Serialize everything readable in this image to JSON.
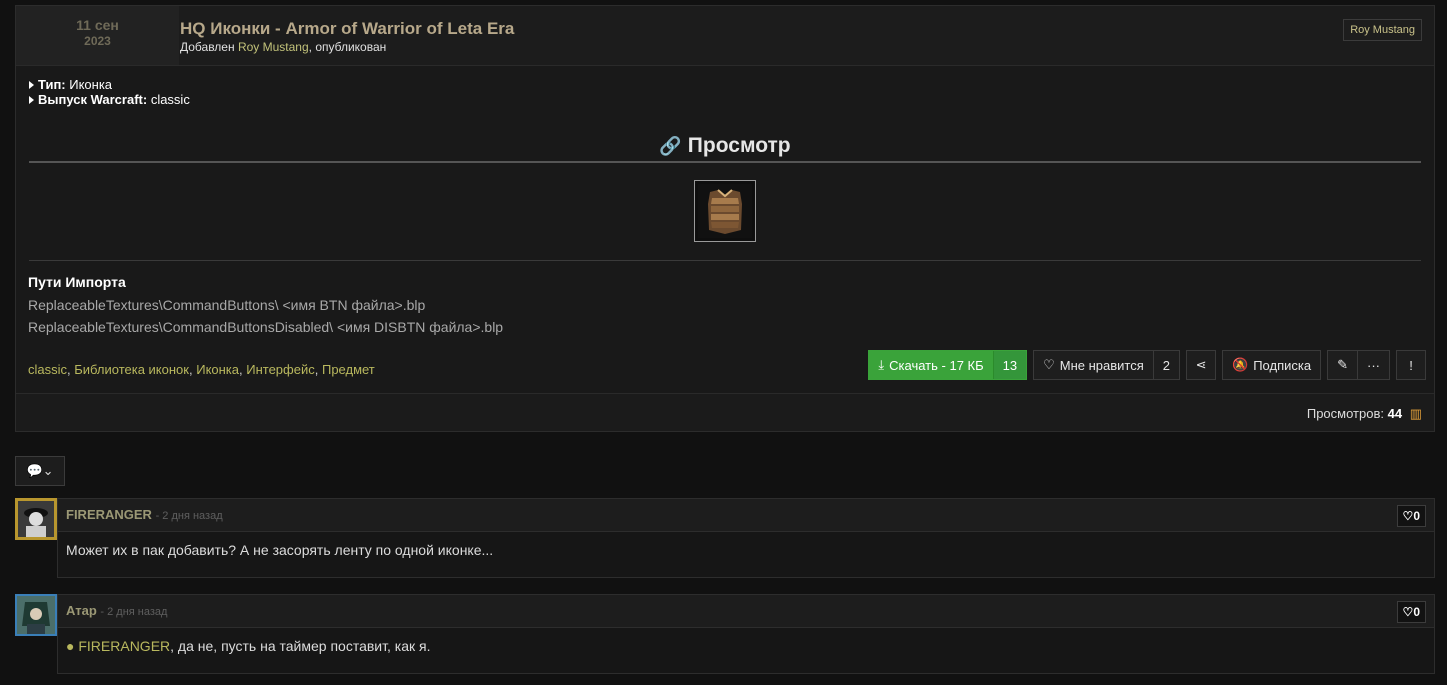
{
  "post": {
    "date_day": "11 сен",
    "date_year": "2023",
    "title": "HQ Иконки - Armor of Warrior of Leta Era",
    "added_prefix": "Добавлен",
    "author": "Roy Mustang",
    "published_suffix": ", опубликован",
    "author_badge": "Roy Mustang",
    "meta": [
      {
        "label": "Тип:",
        "value": "Иконка"
      },
      {
        "label": "Выпуск Warcraft:",
        "value": "classic"
      }
    ],
    "preview_heading": "Просмотр",
    "import_header": "Пути Импорта",
    "import_lines": [
      "ReplaceableTextures\\CommandButtons\\ <имя BTN файла>.blp",
      "ReplaceableTextures\\CommandButtonsDisabled\\ <имя DISBTN файла>.blp"
    ],
    "tags": [
      "classic",
      "Библиотека иконок",
      "Иконка",
      "Интерфейс",
      "Предмет"
    ],
    "download_label": "Скачать - 17 КБ",
    "download_count": "13",
    "like_label": "Мне нравится",
    "like_count": "2",
    "subscribe_label": "Подписка",
    "report_label": "!",
    "more_label": "···",
    "views_label": "Просмотров:",
    "views_count": "44"
  },
  "comments": [
    {
      "user": "FIRERANGER",
      "time": "- 2 дня назад",
      "likes": "0",
      "text": "Может их в пак добавить? А не засорять ленту по одной иконке..."
    },
    {
      "user": "Атар",
      "time": "- 2 дня назад",
      "likes": "0",
      "mention": "FIRERANGER",
      "text": ", да не, пусть на таймер поставит, как я."
    }
  ],
  "colors": {
    "accent": "#b9b85e",
    "download": "#3aa33a",
    "views_icon": "#e8a33a"
  }
}
